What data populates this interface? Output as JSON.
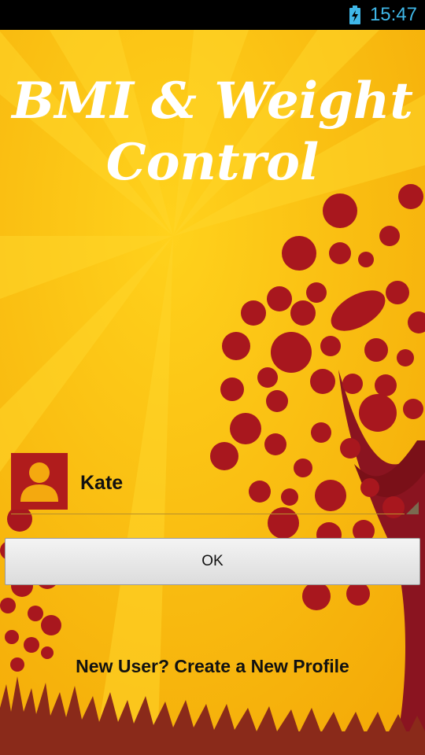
{
  "status_bar": {
    "time": "15:47",
    "battery_icon": "battery-charging-icon",
    "clock_color": "#3fb7e8"
  },
  "app": {
    "title": "BMI & Weight Control"
  },
  "profile": {
    "name": "Kate",
    "avatar_icon": "user-silhouette-icon",
    "avatar_color": "#b01c1c"
  },
  "actions": {
    "ok_label": "OK",
    "new_user_label": "New User? Create a New Profile"
  },
  "theme": {
    "background": "#f5b70a",
    "tree_color": "#a8171e"
  }
}
